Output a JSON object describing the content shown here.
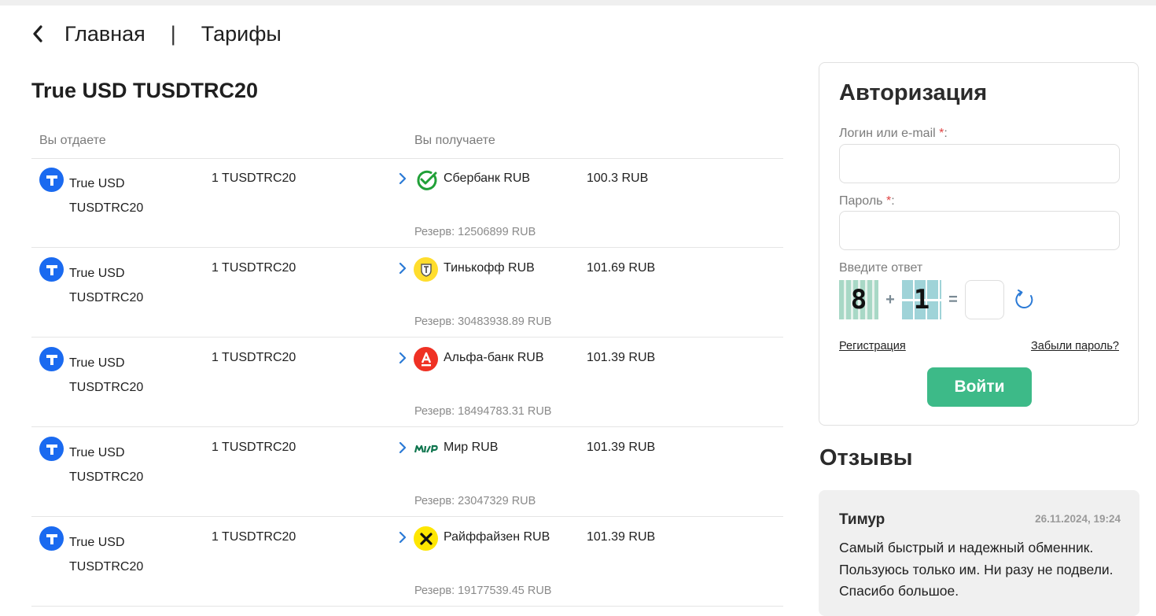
{
  "breadcrumb": {
    "home": "Главная",
    "separator": "|",
    "current": "Тарифы"
  },
  "page": {
    "title": "True USD TUSDTRC20"
  },
  "table": {
    "col_give": "Вы отдаете",
    "col_get": "Вы получаете",
    "rows": [
      {
        "from_name": "True USD TUSDTRC20",
        "from_amount": "1 TUSDTRC20",
        "bank_icon": "sberbank-icon",
        "to_name": "Сбербанк RUB",
        "to_amount": "100.3 RUB",
        "reserve": "Резерв: 12506899 RUB"
      },
      {
        "from_name": "True USD TUSDTRC20",
        "from_amount": "1 TUSDTRC20",
        "bank_icon": "tinkoff-icon",
        "to_name": "Тинькофф RUB",
        "to_amount": "101.69 RUB",
        "reserve": "Резерв: 30483938.89 RUB"
      },
      {
        "from_name": "True USD TUSDTRC20",
        "from_amount": "1 TUSDTRC20",
        "bank_icon": "alfa-bank-icon",
        "to_name": "Альфа-банк RUB",
        "to_amount": "101.39 RUB",
        "reserve": "Резерв: 18494783.31 RUB"
      },
      {
        "from_name": "True USD TUSDTRC20",
        "from_amount": "1 TUSDTRC20",
        "bank_icon": "mir-icon",
        "to_name": "Мир RUB",
        "to_amount": "101.39 RUB",
        "reserve": "Резерв: 23047329 RUB"
      },
      {
        "from_name": "True USD TUSDTRC20",
        "from_amount": "1 TUSDTRC20",
        "bank_icon": "raiffeisen-icon",
        "to_name": "Райффайзен RUB",
        "to_amount": "101.39 RUB",
        "reserve": "Резерв: 19177539.45 RUB"
      }
    ]
  },
  "auth": {
    "title": "Авторизация",
    "login_label": "Логин или e-mail ",
    "password_label": "Пароль ",
    "required_mark": "*",
    "colon": ":",
    "login_value": "",
    "password_value": "",
    "captcha_label": "Введите ответ",
    "captcha_a": "8",
    "captcha_op": "+",
    "captcha_b": "1",
    "captcha_eq": "=",
    "captcha_answer": "",
    "register_link": "Регистрация",
    "forgot_link": "Забыли пароль?",
    "submit": "Войти"
  },
  "reviews": {
    "title": "Отзывы",
    "items": [
      {
        "author": "Тимур",
        "date": "26.11.2024, 19:24",
        "text": "Самый быстрый и надежный обменник. Пользуюсь только им. Ни разу не подвели. Спасибо большое."
      }
    ]
  },
  "colors": {
    "accent_green": "#3dba88",
    "coin_blue": "#1a6af0",
    "link_blue": "#2b7ad6"
  }
}
